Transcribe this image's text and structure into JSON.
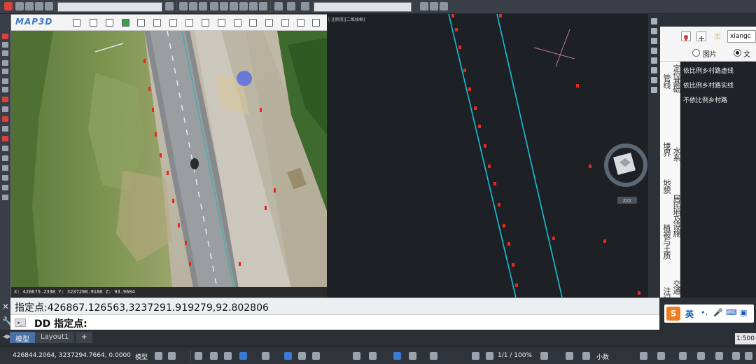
{
  "map_panel": {
    "logo": "MAP3D",
    "coord_readout": "X: 426675.2398   Y: 3237298.9186   Z: 93.9604"
  },
  "cad_panel": {
    "viewport_title": "[-][俯视][二维线框]",
    "grip_label": "ZZZ"
  },
  "palette": {
    "search_value": "xiangc",
    "radio_image_label": "图片",
    "radio_text_label": "文字",
    "categories": [
      "管线",
      "定位基础",
      "境界",
      "水系",
      "地貌",
      "居民地及设施",
      "植被与土质",
      "交通",
      "注记"
    ],
    "list_items": [
      "依比例乡村路虚线",
      "依比例乡村路实线",
      "不依比例乡村路"
    ]
  },
  "command": {
    "history_line": "指定点:426867.126563,3237291.919279,92.802806",
    "prompt_line": "DD 指定点:",
    "prompt_icon": "command-prompt-icon"
  },
  "tabs": {
    "model_label": "模型",
    "layout_label": "Layout1",
    "add_label": "+"
  },
  "ime": {
    "lang_label": "英"
  },
  "status": {
    "coordinates": "426844.2064, 3237294.7664, 0.0000",
    "model_button": "模型",
    "scale_label": "1/1 / 100%",
    "decimal_label": "小数",
    "annotation_scale": "1:500"
  },
  "colors": {
    "road_line": "#17c0d8",
    "marker": "#e8281e",
    "cad_background": "#1d2126",
    "palette_list_background": "#1f2228",
    "cursor_dot": "#5a6fe0"
  }
}
